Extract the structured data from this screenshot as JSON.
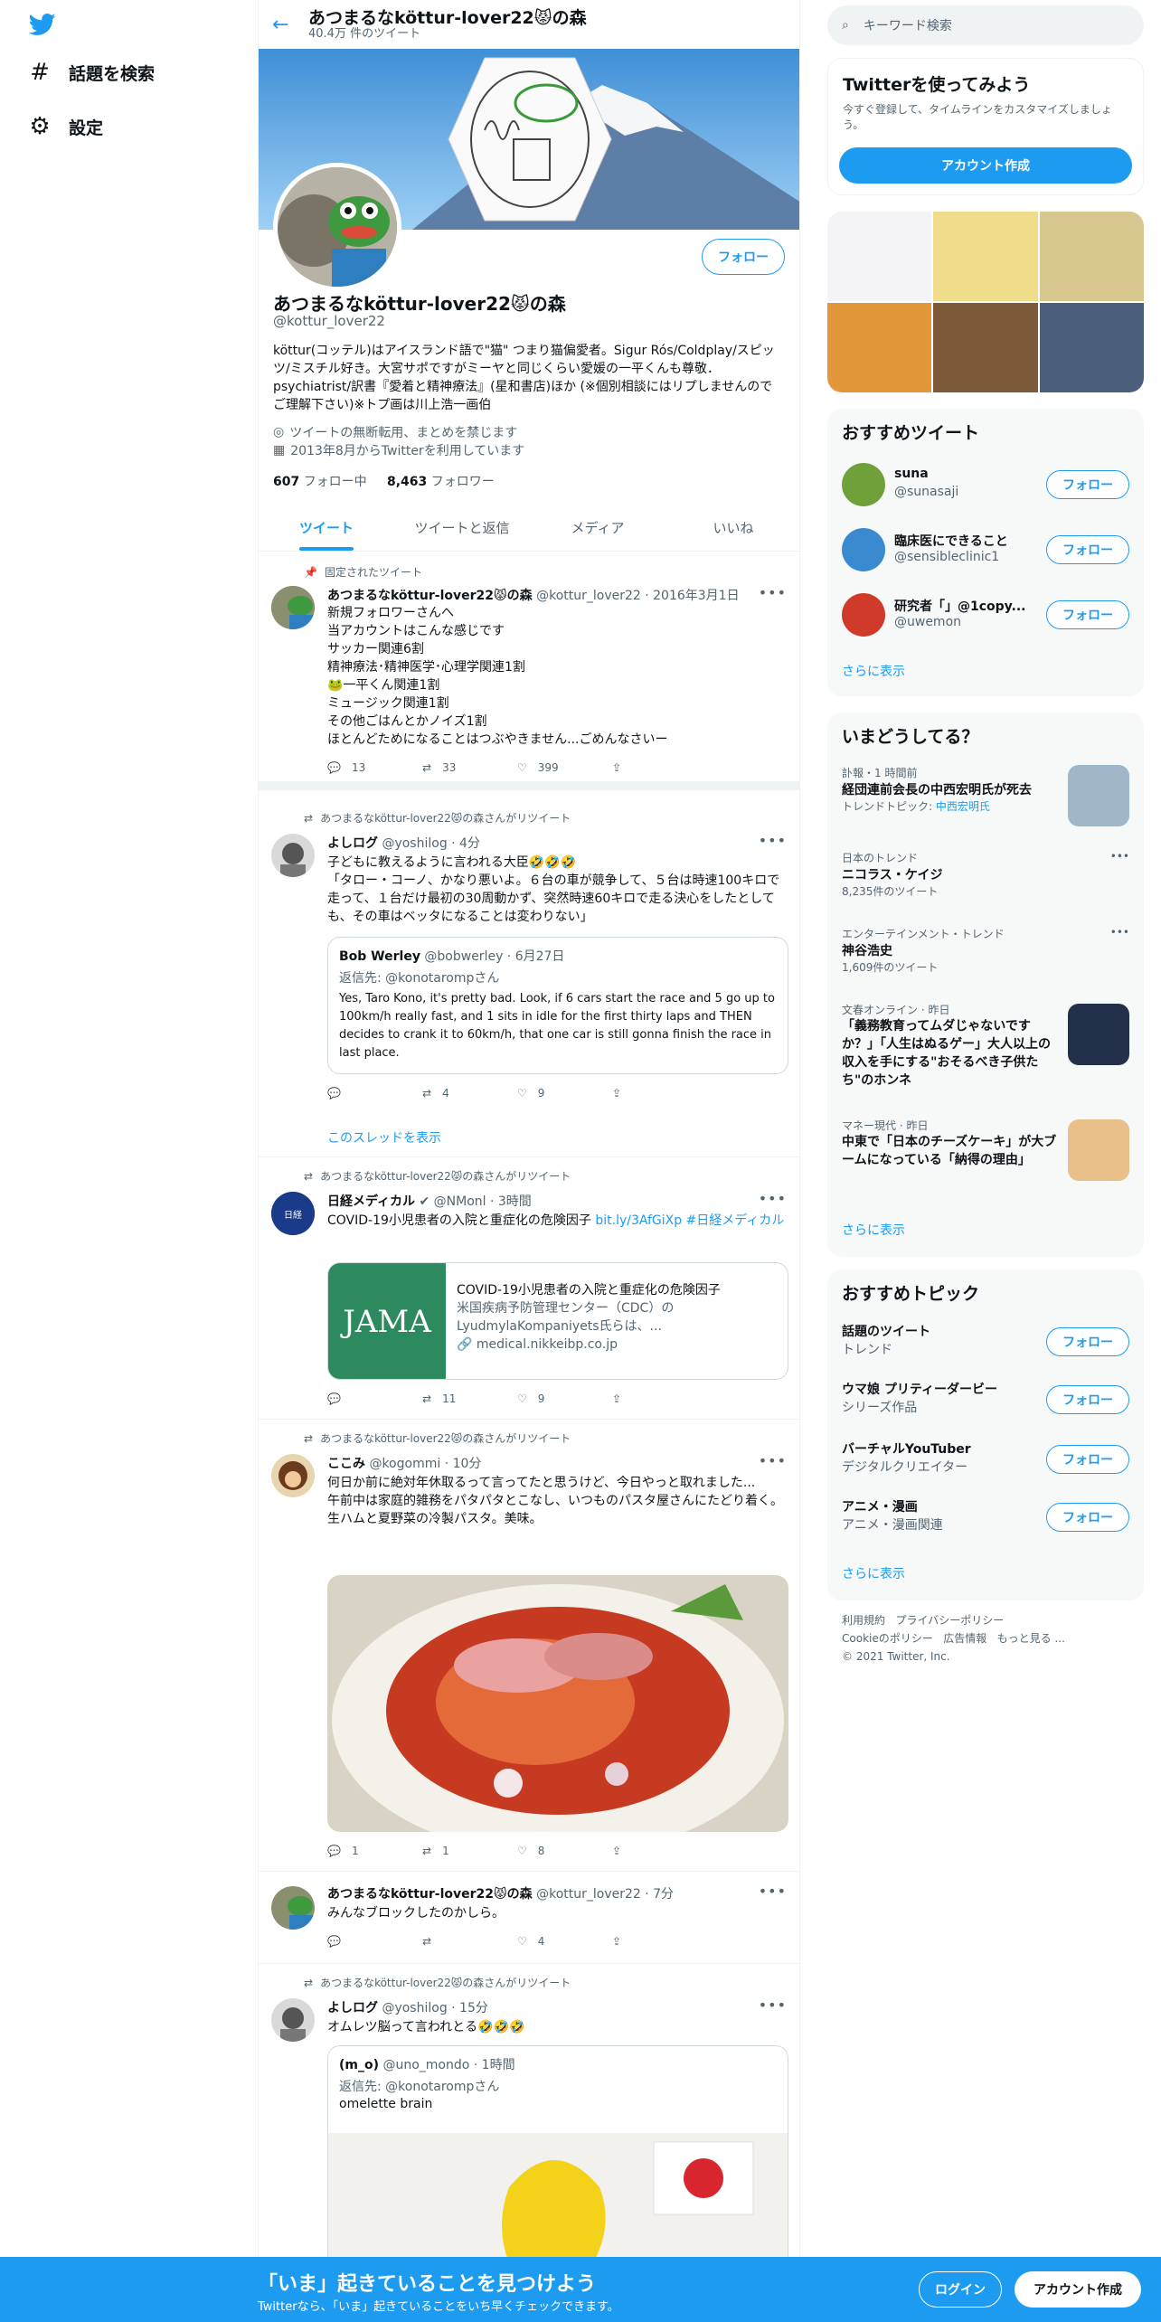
{
  "nav": {
    "explore": "話題を検索",
    "settings": "設定"
  },
  "header": {
    "title": "あつまるなköttur-lover22😾の森",
    "tweet_count": "40.4万 件のツイート"
  },
  "profile": {
    "name": "あつまるなköttur-lover22😾の森",
    "handle": "@kottur_lover22",
    "follow_label": "フォロー",
    "bio": "köttur(コッテル)はアイスランド語で\"猫\" つまり猫偏愛者。Sigur Rós/Coldplay/スピッツ/ミスチル好き。大宮サポですがミーヤと同じくらい愛媛の一平くんも尊敬．psychiatrist/訳書『愛着と精神療法』(星和書店)ほか (※個別相談にはリプしませんのでご理解下さい)※トプ画は川上浩一画伯",
    "location": "ツイートの無断転用、まとめを禁じます",
    "joined": "2013年8月からTwitterを利用しています",
    "following_count": "607",
    "following_label": "フォロー中",
    "followers_count": "8,463",
    "followers_label": "フォロワー"
  },
  "tabs": [
    "ツイート",
    "ツイートと返信",
    "メディア",
    "いいね"
  ],
  "tweets": {
    "pinned": {
      "label": "固定されたツイート",
      "name": "あつまるなköttur-lover22😾の森",
      "meta": "@kottur_lover22 · 2016年3月1日",
      "lines": [
        "新規フォロワーさんへ",
        "当アカウントはこんな感じです",
        "サッカー関連6割",
        "精神療法･精神医学･心理学関連1割",
        "🐸一平くん関連1割",
        "ミュージック関連1割",
        "その他ごはんとかノイズ1割",
        "ほとんどためになることはつぶやきません...ごめんなさいー"
      ],
      "replies": "13",
      "retweets": "33",
      "likes": "399"
    },
    "t2": {
      "ctx": "あつまるなköttur-lover22😾の森さんがリツイート",
      "name": "よしログ",
      "meta": "@yoshilog · 4分",
      "text1": "子どもに教えるように言われる大臣🤣🤣🤣",
      "text2": "「タロー・コーノ、かなり悪いよ。６台の車が競争して、５台は時速100キロで走って、１台だけ最初の30周動かず、突然時速60キロで走る決心をしたとしても、その車はベッタになることは変わりない」",
      "q_name": "Bob Werley",
      "q_meta": "@bobwerley · 6月27日",
      "q_reply": "返信先: @konotarompさん",
      "q_text": "Yes, Taro Kono, it's pretty bad. Look, if 6 cars start the race and 5 go up to 100km/h really fast, and 1 sits in idle for the first thirty laps and THEN decides to crank it to 60km/h, that one car is still gonna finish the race in last place.",
      "replies": "",
      "retweets": "4",
      "likes": "9",
      "show_thread": "このスレッドを表示"
    },
    "t3": {
      "ctx": "あつまるなköttur-lover22😾の森さんがリツイート",
      "name": "日経メディカル",
      "meta": "@NMonl · 3時間",
      "text": "COVID-19小児患者の入院と重症化の危険因子",
      "link": "bit.ly/3AfGiXp #日経メディカル",
      "card_img": "JAMA",
      "card_title": "COVID-19小児患者の入院と重症化の危険因子",
      "card_desc": "米国疾病予防管理センター（CDC）のLyudmylaKompaniyets氏らは、...",
      "card_url": "medical.nikkeibp.co.jp",
      "replies": "",
      "retweets": "11",
      "likes": "9"
    },
    "t4": {
      "ctx": "あつまるなköttur-lover22😾の森さんがリツイート",
      "name": "ここみ",
      "meta": "@kogommi · 10分",
      "lines": [
        "何日か前に絶対年休取るって言ってたと思うけど、今日やっと取れました...",
        "午前中は家庭的雑務をパタパタとこなし、いつものパスタ屋さんにたどり着く。",
        "生ハムと夏野菜の冷製パスタ。美味。"
      ],
      "replies": "1",
      "retweets": "1",
      "likes": "8"
    },
    "t5": {
      "name": "あつまるなköttur-lover22😾の森",
      "meta": "@kottur_lover22 · 7分",
      "text": "みんなブロックしたのかしら。",
      "replies": "",
      "retweets": "",
      "likes": "4"
    },
    "t6": {
      "ctx": "あつまるなköttur-lover22😾の森さんがリツイート",
      "name": "よしログ",
      "meta": "@yoshilog · 15分",
      "text": "オムレツ脳って言われとる🤣🤣🤣",
      "q_name": "(m_o)",
      "q_meta": "@uno_mondo · 1時間",
      "q_reply": "返信先: @konotarompさん",
      "q_text": "omelette brain"
    }
  },
  "right": {
    "search_placeholder": "キーワード検索",
    "signup": {
      "title": "Twitterを使ってみよう",
      "desc": "今すぐ登録して、タイムラインをカスタマイズしましょう。",
      "button": "アカウント作成"
    },
    "recommended": {
      "title": "おすすめツイート",
      "follow": "フォロー",
      "show_more": "さらに表示",
      "users": [
        {
          "name": "suna",
          "handle": "@sunasaji"
        },
        {
          "name": "臨床医にできること",
          "handle": "@sensibleclinic1"
        },
        {
          "name": "研究者「」@1copy...",
          "handle": "@uwemon"
        }
      ]
    },
    "trends": {
      "title": "いまどうしてる？",
      "show_more": "さらに表示",
      "items": [
        {
          "meta": "訃報・1 時間前",
          "title": "経団連前会長の中西宏明氏が死去",
          "sub_label": "トレンドトピック: ",
          "sub_link": "中西宏明氏"
        },
        {
          "meta": "日本のトレンド",
          "title": "ニコラス・ケイジ",
          "sub": "8,235件のツイート"
        },
        {
          "meta": "エンターテインメント・トレンド",
          "title": "神谷浩史",
          "sub": "1,609件のツイート"
        },
        {
          "meta": "文春オンライン · 昨日",
          "title": "「義務教育ってムダじゃないですか？」「人生はぬるゲー」大人以上の収入を手にする\"おそるべき子供たち\"のホンネ"
        },
        {
          "meta": "マネー現代 · 昨日",
          "title": "中東で「日本のチーズケーキ」が大ブームになっている「納得の理由」"
        }
      ]
    },
    "topics": {
      "title": "おすすめトピック",
      "follow": "フォロー",
      "show_more": "さらに表示",
      "items": [
        {
          "title": "話題のツイート",
          "sub": "トレンド"
        },
        {
          "title": "ウマ娘 プリティーダービー",
          "sub": "シリーズ作品"
        },
        {
          "title": "バーチャルYouTuber",
          "sub": "デジタルクリエイター"
        },
        {
          "title": "アニメ・漫画",
          "sub": "アニメ・漫画関連"
        }
      ]
    },
    "footer": {
      "terms": "利用規約",
      "privacy": "プライバシーポリシー",
      "cookie": "Cookieのポリシー",
      "ads": "広告情報",
      "more": "もっと見る ...",
      "copy": "© 2021 Twitter, Inc."
    }
  },
  "bottom": {
    "title": "「いま」起きていることを見つけよう",
    "sub": "Twitterなら、「いま」起きていることをいち早くチェックできます。",
    "login": "ログイン",
    "signup": "アカウント作成"
  },
  "colors": {
    "accent": "#1d9bf0",
    "text": "#0f1419",
    "muted": "#536471"
  }
}
